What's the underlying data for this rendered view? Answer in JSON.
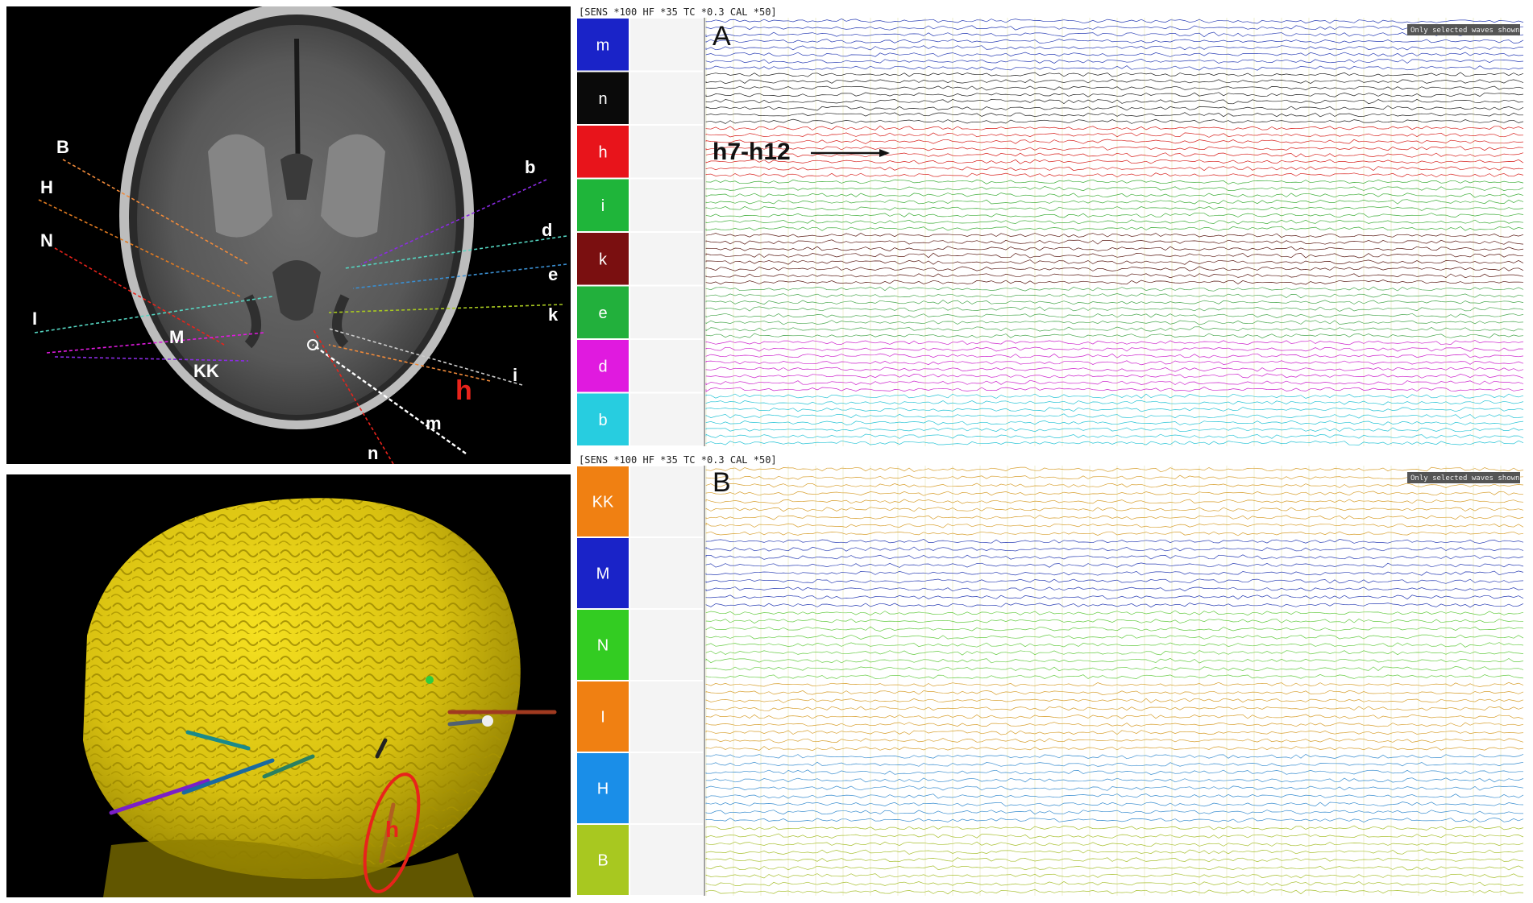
{
  "mri": {
    "labels": [
      {
        "id": "B",
        "text": "B",
        "color": "#ffffff"
      },
      {
        "id": "H",
        "text": "H",
        "color": "#ffffff"
      },
      {
        "id": "N",
        "text": "N",
        "color": "#ffffff"
      },
      {
        "id": "I",
        "text": "I",
        "color": "#ffffff"
      },
      {
        "id": "M",
        "text": "M",
        "color": "#ffffff"
      },
      {
        "id": "KK",
        "text": "KK",
        "color": "#ffffff"
      },
      {
        "id": "b",
        "text": "b",
        "color": "#ffffff"
      },
      {
        "id": "d",
        "text": "d",
        "color": "#ffffff"
      },
      {
        "id": "e",
        "text": "e",
        "color": "#ffffff"
      },
      {
        "id": "k",
        "text": "k",
        "color": "#ffffff"
      },
      {
        "id": "i",
        "text": "i",
        "color": "#ffffff"
      },
      {
        "id": "h",
        "text": "h",
        "color": "#e8231b"
      },
      {
        "id": "m",
        "text": "m",
        "color": "#ffffff"
      },
      {
        "id": "n",
        "text": "n",
        "color": "#ffffff"
      }
    ]
  },
  "brain3d": {
    "highlight_label": "h",
    "highlight_color": "#e8231b"
  },
  "eeg_a": {
    "header": "[SENS *100   HF *35   TC *0.3   CAL *50]",
    "panel_label": "A",
    "annotation": "h7-h12",
    "badge": "Only selected waves shown",
    "blocks": [
      {
        "label": "m",
        "color": "#1a23c8",
        "wave": "#2b3fb5"
      },
      {
        "label": "n",
        "color": "#0a0a0a",
        "wave": "#222222"
      },
      {
        "label": "h",
        "color": "#e8141b",
        "wave": "#d8231f"
      },
      {
        "label": "i",
        "color": "#1fb53a",
        "wave": "#3fae3a"
      },
      {
        "label": "k",
        "color": "#7a0f10",
        "wave": "#5a1a14"
      },
      {
        "label": "e",
        "color": "#22b03c",
        "wave": "#4aa850"
      },
      {
        "label": "d",
        "color": "#e01adf",
        "wave": "#cc22cc"
      },
      {
        "label": "b",
        "color": "#27cde0",
        "wave": "#28c4d6"
      }
    ]
  },
  "eeg_b": {
    "header": "[SENS *100   HF *35   TC *0.3   CAL *50]",
    "panel_label": "B",
    "badge": "Only selected waves shown",
    "blocks": [
      {
        "label": "KK",
        "color": "#f08012",
        "wave": "#d8a030"
      },
      {
        "label": "M",
        "color": "#1a23c8",
        "wave": "#2b3fb5"
      },
      {
        "label": "N",
        "color": "#33cc22",
        "wave": "#66cc44"
      },
      {
        "label": "I",
        "color": "#f08012",
        "wave": "#d8a030"
      },
      {
        "label": "H",
        "color": "#1a8ee8",
        "wave": "#3a8ed0"
      },
      {
        "label": "B",
        "color": "#a8c820",
        "wave": "#a8c030"
      }
    ]
  }
}
